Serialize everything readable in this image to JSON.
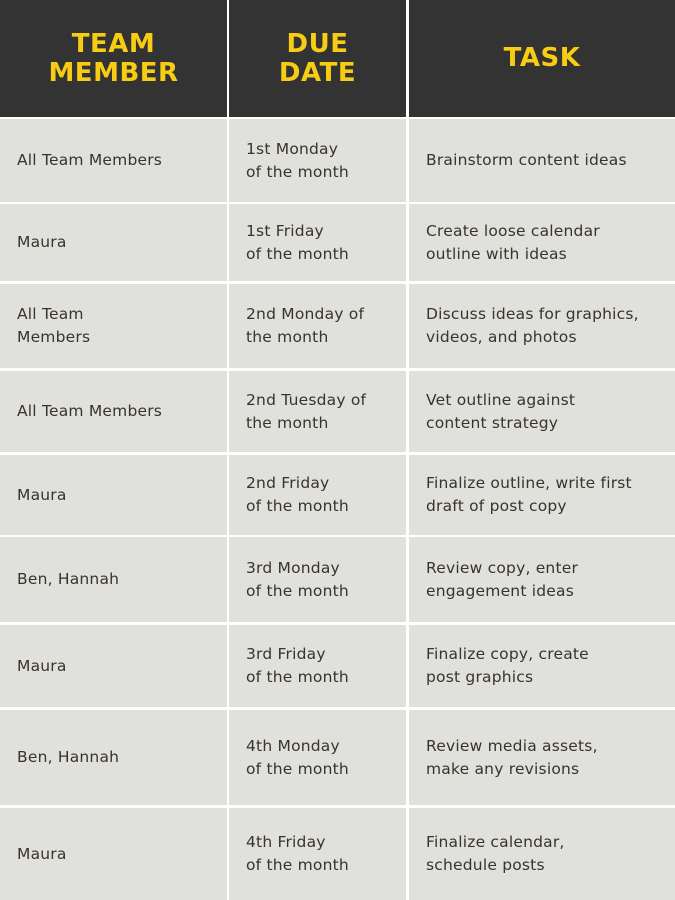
{
  "colors": {
    "header_bg": "#333333",
    "header_text": "#f7cc12",
    "cell_bg": "#e0e0dd",
    "cell_text": "#3a3329",
    "grid_lines": "#ffffff"
  },
  "header": {
    "team_member": "TEAM\nMEMBER",
    "due_date": "DUE\nDATE",
    "task": "TASK"
  },
  "rows": [
    {
      "member": "All Team Members",
      "due": "1st Monday\nof the month",
      "task": "Brainstorm content ideas"
    },
    {
      "member": "Maura",
      "due": "1st Friday\nof the month",
      "task": "Create loose calendar\noutline with ideas"
    },
    {
      "member": "All Team\nMembers",
      "due": "2nd Monday of\nthe month",
      "task": "Discuss ideas for graphics,\nvideos, and photos"
    },
    {
      "member": "All Team Members",
      "due": "2nd Tuesday of\nthe month",
      "task": "Vet outline against\ncontent strategy"
    },
    {
      "member": "Maura",
      "due": "2nd Friday\nof the month",
      "task": "Finalize outline, write first\ndraft of post copy"
    },
    {
      "member": "Ben, Hannah",
      "due": "3rd Monday\nof the month",
      "task": "Review copy, enter\nengagement ideas"
    },
    {
      "member": "Maura",
      "due": "3rd Friday\nof the month",
      "task": "Finalize copy, create\npost graphics"
    },
    {
      "member": "Ben, Hannah",
      "due": "4th Monday\nof the month",
      "task": "Review media assets,\nmake any revisions"
    },
    {
      "member": "Maura",
      "due": "4th Friday\nof the month",
      "task": "Finalize calendar,\nschedule posts"
    }
  ]
}
